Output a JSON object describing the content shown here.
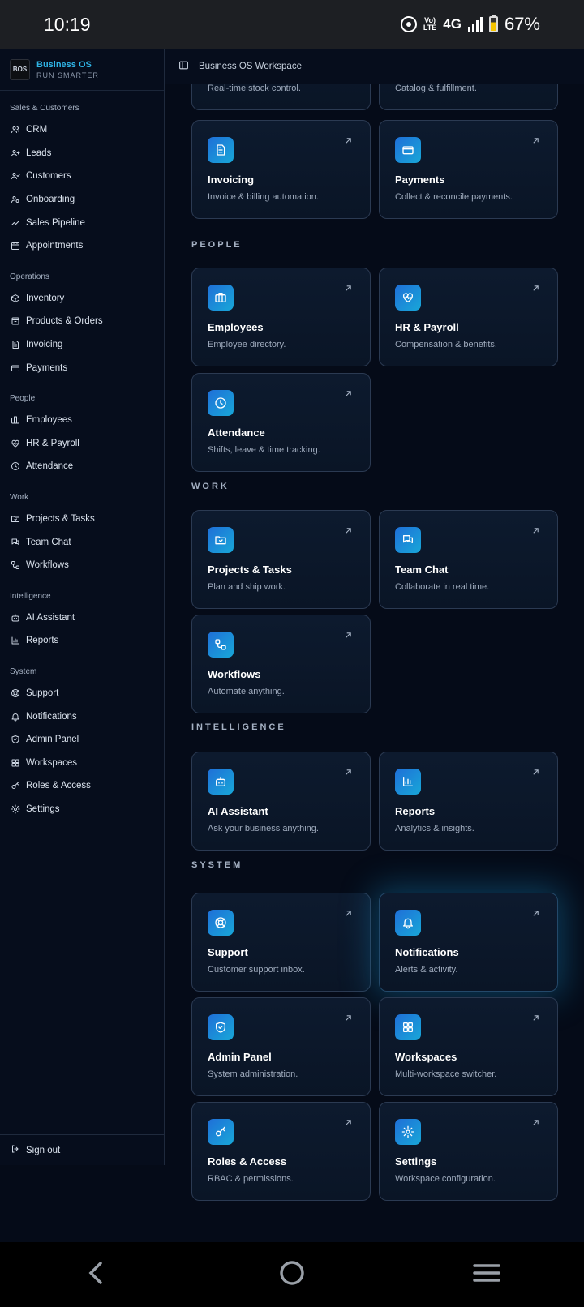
{
  "status": {
    "time": "10:19",
    "network": "4G",
    "volte": "Vo) LTE",
    "battery": "67%",
    "battery_level": 0.67
  },
  "brand": {
    "name": "Business OS",
    "tagline": "RUN SMARTER",
    "logo_text": "BOS"
  },
  "topbar": {
    "title": "Business OS Workspace"
  },
  "sidebar": {
    "groups": [
      {
        "title": "Sales & Customers",
        "items": [
          {
            "label": "CRM",
            "icon": "users-icon"
          },
          {
            "label": "Leads",
            "icon": "user-plus-icon"
          },
          {
            "label": "Customers",
            "icon": "user-check-icon"
          },
          {
            "label": "Onboarding",
            "icon": "user-cog-icon"
          },
          {
            "label": "Sales Pipeline",
            "icon": "trend-icon"
          },
          {
            "label": "Appointments",
            "icon": "calendar-icon"
          }
        ]
      },
      {
        "title": "Operations",
        "items": [
          {
            "label": "Inventory",
            "icon": "box-icon"
          },
          {
            "label": "Products & Orders",
            "icon": "package-icon"
          },
          {
            "label": "Invoicing",
            "icon": "file-icon"
          },
          {
            "label": "Payments",
            "icon": "card-icon"
          }
        ]
      },
      {
        "title": "People",
        "items": [
          {
            "label": "Employees",
            "icon": "briefcase-icon"
          },
          {
            "label": "HR & Payroll",
            "icon": "heart-pulse-icon"
          },
          {
            "label": "Attendance",
            "icon": "clock-icon"
          }
        ]
      },
      {
        "title": "Work",
        "items": [
          {
            "label": "Projects & Tasks",
            "icon": "folder-icon"
          },
          {
            "label": "Team Chat",
            "icon": "chat-icon"
          },
          {
            "label": "Workflows",
            "icon": "workflow-icon"
          }
        ]
      },
      {
        "title": "Intelligence",
        "items": [
          {
            "label": "AI Assistant",
            "icon": "bot-icon"
          },
          {
            "label": "Reports",
            "icon": "chart-icon"
          }
        ]
      },
      {
        "title": "System",
        "items": [
          {
            "label": "Support",
            "icon": "lifebuoy-icon"
          },
          {
            "label": "Notifications",
            "icon": "bell-icon"
          },
          {
            "label": "Admin Panel",
            "icon": "shield-icon"
          },
          {
            "label": "Workspaces",
            "icon": "grid-icon"
          },
          {
            "label": "Roles & Access",
            "icon": "key-icon"
          },
          {
            "label": "Settings",
            "icon": "gear-icon"
          }
        ]
      }
    ],
    "signout": "Sign out"
  },
  "main": {
    "partial_cards": [
      {
        "desc": "Real-time stock control."
      },
      {
        "desc": "Catalog & fulfillment."
      }
    ],
    "cards_ops": [
      {
        "title": "Invoicing",
        "desc": "Invoice & billing automation.",
        "icon": "file-icon"
      },
      {
        "title": "Payments",
        "desc": "Collect & reconcile payments.",
        "icon": "card-icon"
      }
    ],
    "sections": {
      "people": "PEOPLE",
      "work": "WORK",
      "intelligence": "INTELLIGENCE",
      "system": "SYSTEM"
    },
    "cards_people": [
      {
        "title": "Employees",
        "desc": "Employee directory.",
        "icon": "briefcase-icon"
      },
      {
        "title": "HR & Payroll",
        "desc": "Compensation & benefits.",
        "icon": "heart-pulse-icon"
      },
      {
        "title": "Attendance",
        "desc": "Shifts, leave & time tracking.",
        "icon": "clock-icon"
      }
    ],
    "cards_work": [
      {
        "title": "Projects & Tasks",
        "desc": "Plan and ship work.",
        "icon": "folder-icon"
      },
      {
        "title": "Team Chat",
        "desc": "Collaborate in real time.",
        "icon": "chat-icon"
      },
      {
        "title": "Workflows",
        "desc": "Automate anything.",
        "icon": "workflow-icon"
      }
    ],
    "cards_intel": [
      {
        "title": "AI Assistant",
        "desc": "Ask your business anything.",
        "icon": "bot-icon"
      },
      {
        "title": "Reports",
        "desc": "Analytics & insights.",
        "icon": "chart-icon"
      }
    ],
    "cards_system": [
      {
        "title": "Support",
        "desc": "Customer support inbox.",
        "icon": "lifebuoy-icon"
      },
      {
        "title": "Notifications",
        "desc": "Alerts & activity.",
        "icon": "bell-icon"
      },
      {
        "title": "Admin Panel",
        "desc": "System administration.",
        "icon": "shield-icon"
      },
      {
        "title": "Workspaces",
        "desc": "Multi-workspace switcher.",
        "icon": "grid-icon"
      },
      {
        "title": "Roles & Access",
        "desc": "RBAC & permissions.",
        "icon": "key-icon"
      },
      {
        "title": "Settings",
        "desc": "Workspace configuration.",
        "icon": "gear-icon"
      }
    ]
  },
  "colors": {
    "accent": "#1ea3dc",
    "background": "#050b18",
    "card_border": "#2b3a52"
  }
}
